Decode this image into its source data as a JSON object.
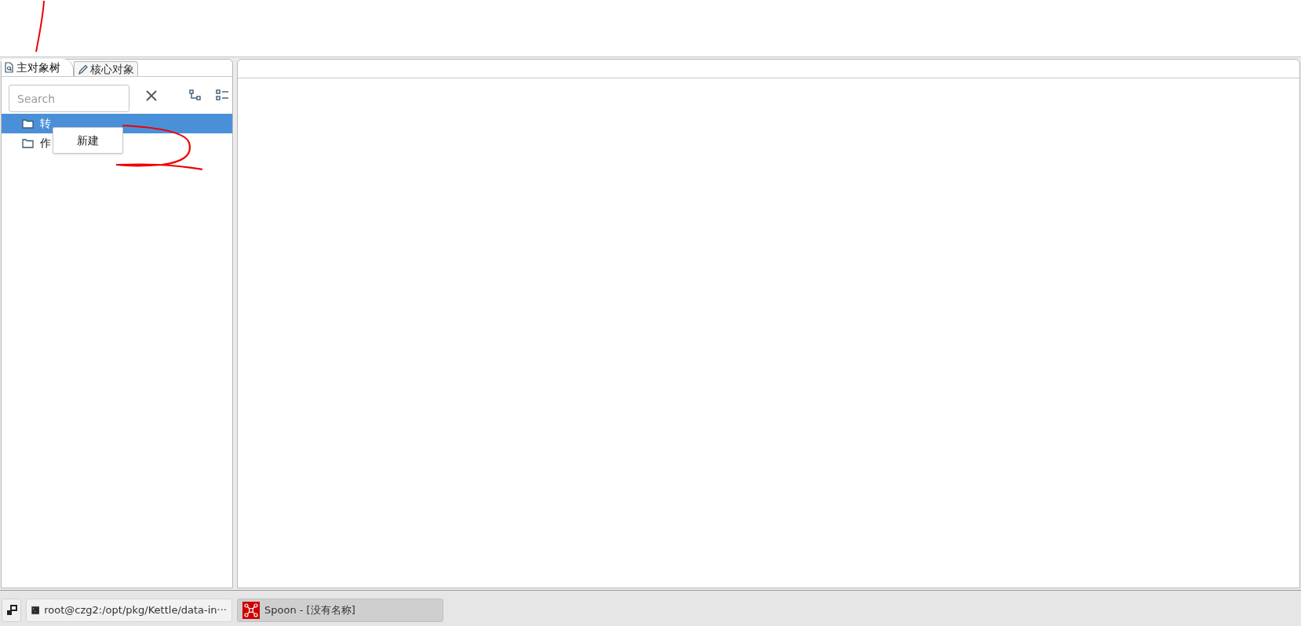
{
  "left_panel": {
    "tabs": [
      {
        "label": "主对象树",
        "selected": true
      },
      {
        "label": "核心对象",
        "selected": false
      }
    ],
    "search": {
      "placeholder": "Search"
    },
    "tree": [
      {
        "label": "转",
        "selected": true
      },
      {
        "label": "作",
        "selected": false
      }
    ],
    "context_menu": {
      "items": [
        "新建"
      ]
    }
  },
  "taskbar": {
    "items": [
      {
        "label": "root@czg2:/opt/pkg/Kettle/data-in···",
        "selected": false
      },
      {
        "label": "Spoon - [没有名称]",
        "selected": true
      }
    ]
  }
}
